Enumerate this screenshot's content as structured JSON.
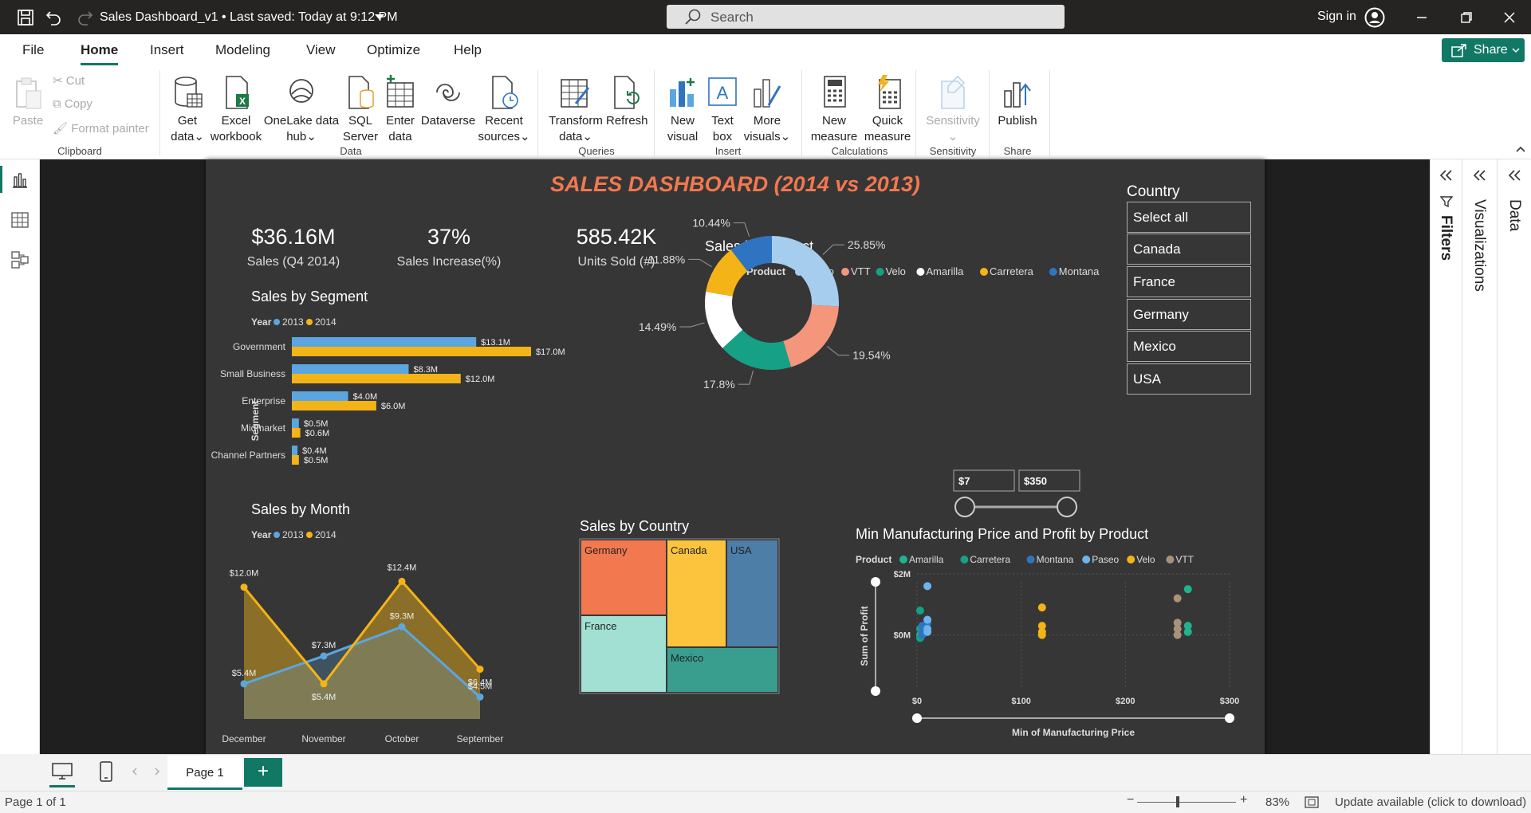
{
  "titlebar": {
    "doc_title": "Sales Dashboard_v1 • Last saved: Today at 9:12 PM",
    "search_placeholder": "Search",
    "signin": "Sign in"
  },
  "tabs": [
    "File",
    "Home",
    "Insert",
    "Modeling",
    "View",
    "Optimize",
    "Help"
  ],
  "share": "Share",
  "ribbon": {
    "clipboard": {
      "paste": "Paste",
      "cut": "Cut",
      "copy": "Copy",
      "format_painter": "Format painter",
      "label": "Clipboard"
    },
    "data": {
      "get_data": [
        "Get",
        "data"
      ],
      "excel": [
        "Excel",
        "workbook"
      ],
      "onelake": [
        "OneLake data",
        "hub"
      ],
      "sql": [
        "SQL",
        "Server"
      ],
      "enter": [
        "Enter",
        "data"
      ],
      "dataverse": [
        "Dataverse"
      ],
      "recent": [
        "Recent",
        "sources"
      ],
      "label": "Data"
    },
    "queries": {
      "transform": [
        "Transform",
        "data"
      ],
      "refresh": [
        "Refresh"
      ],
      "label": "Queries"
    },
    "insert": {
      "new_visual": [
        "New",
        "visual"
      ],
      "text_box": [
        "Text",
        "box"
      ],
      "more_visuals": [
        "More",
        "visuals"
      ],
      "label": "Insert"
    },
    "calculations": {
      "new_measure": [
        "New",
        "measure"
      ],
      "quick_measure": [
        "Quick",
        "measure"
      ],
      "label": "Calculations"
    },
    "sensitivity": {
      "btn": [
        "Sensitivity"
      ],
      "label": "Sensitivity"
    },
    "share": {
      "publish": [
        "Publish"
      ],
      "label": "Share"
    }
  },
  "panes": {
    "filters": "Filters",
    "visualizations": "Visualizations",
    "data": "Data"
  },
  "pagebar": {
    "page1": "Page 1",
    "add": "+"
  },
  "status": {
    "page": "Page 1 of 1",
    "zoom": "83%",
    "update": "Update available (click to download)"
  },
  "report": {
    "title": "SALES DASHBOARD (2014 vs 2013)",
    "kpis": [
      {
        "value": "$36.16M",
        "label": "Sales (Q4 2014)"
      },
      {
        "value": "37%",
        "label": "Sales Increase(%)"
      },
      {
        "value": "585.42K",
        "label": "Units Sold (#)"
      }
    ],
    "segment": {
      "title": "Sales by Segment",
      "legend_title": "Year",
      "axis_label": "Segment",
      "series_names": [
        "2013",
        "2014"
      ],
      "colors": {
        "2013": "#5ba6e0",
        "2014": "#f4b317"
      }
    },
    "month": {
      "title": "Sales by Month",
      "legend_title": "Year",
      "series_names": [
        "2013",
        "2014"
      ]
    },
    "product": {
      "title": "Sales by Product",
      "legend_title": "Product"
    },
    "country": {
      "title": "Sales by Country"
    },
    "scatter": {
      "title": "Min Manufacturing Price and Profit by Product",
      "legend_title": "Product",
      "xlabel": "Min of Manufacturing Price",
      "ylabel": "Sum of Profit"
    },
    "slicer": {
      "title": "Country",
      "items": [
        "Select all",
        "Canada",
        "France",
        "Germany",
        "Mexico",
        "USA"
      ]
    },
    "price_range": {
      "min": "$7",
      "max": "$350"
    }
  },
  "chart_data": [
    {
      "type": "bar",
      "title": "Sales by Segment",
      "categories": [
        "Government",
        "Small Business",
        "Enterprise",
        "Midmarket",
        "Channel Partners"
      ],
      "series": [
        {
          "name": "2013",
          "values": [
            13.1,
            8.3,
            4.0,
            0.5,
            0.4
          ],
          "labels": [
            "$13.1M",
            "$8.3M",
            "$4.0M",
            "$0.5M",
            "$0.4M"
          ]
        },
        {
          "name": "2014",
          "values": [
            17.0,
            12.0,
            6.0,
            0.6,
            0.5
          ],
          "labels": [
            "$17.0M",
            "$12.0M",
            "$6.0M",
            "$0.6M",
            "$0.5M"
          ]
        }
      ],
      "ylabel": "Segment",
      "xlim": [
        0,
        17.0
      ]
    },
    {
      "type": "area",
      "title": "Sales by Month",
      "categories": [
        "December",
        "November",
        "October",
        "September"
      ],
      "series": [
        {
          "name": "2013",
          "values": [
            5.4,
            7.3,
            9.3,
            4.5
          ],
          "labels": [
            "$5.4M",
            "$7.3M",
            "$9.3M",
            "$4.5M"
          ],
          "color": "#5ba6e0"
        },
        {
          "name": "2014",
          "values": [
            12.0,
            5.4,
            12.4,
            6.4
          ],
          "labels": [
            "$12.0M",
            "$5.4M",
            "$12.4M",
            "$6.4M"
          ],
          "color": "#f4b317"
        }
      ],
      "ylim": [
        3.0,
        14.0
      ]
    },
    {
      "type": "pie",
      "title": "Sales by Product",
      "legend": [
        "Paseo",
        "VTT",
        "Velo",
        "Amarilla",
        "Carretera",
        "Montana"
      ],
      "slices": [
        {
          "name": "Paseo",
          "value": 25.85,
          "label": "25.85%",
          "color": "#a6cdee"
        },
        {
          "name": "VTT",
          "value": 19.54,
          "label": "19.54%",
          "color": "#f4967c"
        },
        {
          "name": "Velo",
          "value": 17.8,
          "label": "17.8%",
          "color": "#16a085"
        },
        {
          "name": "Amarilla",
          "value": 14.49,
          "label": "14.49%",
          "color": "#ffffff"
        },
        {
          "name": "Carretera",
          "value": 11.88,
          "label": "11.88%",
          "color": "#f4b317"
        },
        {
          "name": "Montana",
          "value": 10.44,
          "label": "10.44%",
          "color": "#2f74c0"
        }
      ]
    },
    {
      "type": "heatmap",
      "title": "Sales by Country",
      "cells": [
        {
          "name": "Germany",
          "color": "#f2784f"
        },
        {
          "name": "Canada",
          "color": "#fcc43d"
        },
        {
          "name": "USA",
          "color": "#4d7ea8"
        },
        {
          "name": "France",
          "color": "#a2e0d3"
        },
        {
          "name": "Mexico",
          "color": "#3a9e8e"
        }
      ]
    },
    {
      "type": "scatter",
      "title": "Min Manufacturing Price and Profit by Product",
      "xlabel": "Min of Manufacturing Price",
      "ylabel": "Sum of Profit",
      "xticks": [
        "$0",
        "$100",
        "$200",
        "$300"
      ],
      "yticks": [
        "$0M",
        "$2M"
      ],
      "xlim": [
        0,
        300
      ],
      "ylim": [
        -1.0,
        2.0
      ],
      "series": [
        {
          "name": "Amarilla",
          "color": "#20b38f",
          "points": [
            [
              3,
              0.0
            ],
            [
              260,
              1.5
            ],
            [
              260,
              0.3
            ],
            [
              260,
              0.1
            ]
          ]
        },
        {
          "name": "Carretera",
          "color": "#16a085",
          "points": [
            [
              3,
              0.8
            ],
            [
              3,
              0.2
            ],
            [
              3,
              -0.1
            ]
          ]
        },
        {
          "name": "Montana",
          "color": "#2f74c0",
          "points": [
            [
              5,
              0.3
            ],
            [
              5,
              0.1
            ],
            [
              5,
              0.0
            ],
            [
              10,
              0.4
            ]
          ]
        },
        {
          "name": "Paseo",
          "color": "#6cb4ee",
          "points": [
            [
              10,
              1.6
            ],
            [
              10,
              0.5
            ],
            [
              10,
              0.2
            ],
            [
              10,
              0.1
            ]
          ]
        },
        {
          "name": "Velo",
          "color": "#f4b317",
          "points": [
            [
              120,
              0.9
            ],
            [
              120,
              0.3
            ],
            [
              120,
              0.1
            ],
            [
              120,
              0.0
            ]
          ]
        },
        {
          "name": "VTT",
          "color": "#a99279",
          "points": [
            [
              250,
              1.2
            ],
            [
              250,
              0.4
            ],
            [
              250,
              0.2
            ],
            [
              250,
              0.0
            ]
          ]
        }
      ]
    }
  ]
}
